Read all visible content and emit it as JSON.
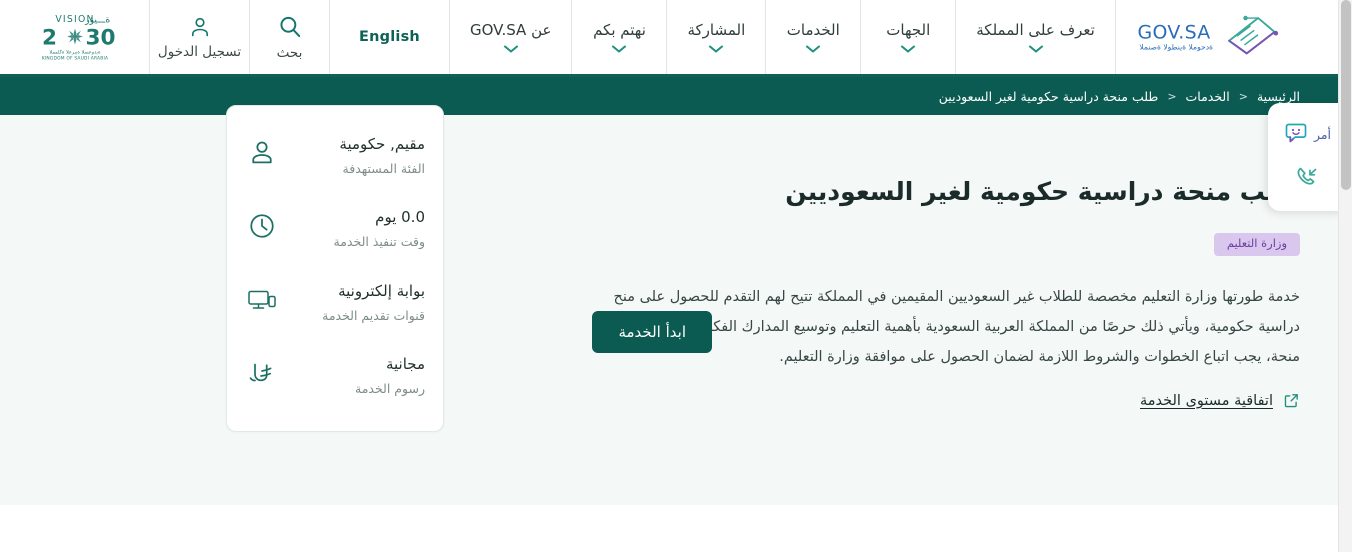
{
  "header": {
    "vision_logo": {
      "name": "vision-2030-logo",
      "word_vision": "VISION",
      "word_vision_ar": "رؤية",
      "year": "2030",
      "sub_ar": "المملكة العربية السعودية",
      "sub_en": "KINGDOM OF SAUDI ARABIA"
    },
    "login": {
      "label": "تسجيل الدخول",
      "icon": "user-icon"
    },
    "search": {
      "label": "بحث",
      "icon": "search-icon"
    },
    "language": {
      "label": "English"
    },
    "nav": [
      {
        "label": "عن GOV.SA",
        "icon": "chevron-down-icon"
      },
      {
        "label": "نهتم بكم",
        "icon": "chevron-down-icon"
      },
      {
        "label": "المشاركة",
        "icon": "chevron-down-icon"
      },
      {
        "label": "الخدمات",
        "icon": "chevron-down-icon"
      },
      {
        "label": "الجهات",
        "icon": "chevron-down-icon"
      },
      {
        "label": "تعرف على المملكة",
        "icon": "chevron-down-icon"
      }
    ],
    "govsa_logo": {
      "name": "govsa-logo",
      "wordmark": "GOV.SA",
      "tagline": "المنصة الوطنية الموحدة"
    }
  },
  "breadcrumb": {
    "items": [
      {
        "label": "الرئيسية"
      },
      {
        "label": "الخدمات"
      },
      {
        "label": "طلب منحة دراسية حكومية لغير السعوديين"
      }
    ],
    "separator": "<"
  },
  "service": {
    "title": "طلب منحة دراسية حكومية لغير السعوديين",
    "ministry_badge": "وزارة التعليم",
    "description": "خدمة طورتها وزارة التعليم مخصصة للطلاب غير السعوديين المقيمين في المملكة تتيح لهم التقدم للحصول على منح دراسية حكومية، ويأتي ذلك حرصًا من المملكة العربية السعودية بأهمية التعليم وتوسيع المدارك الفكرية. وللتقدم بطلب منحة، يجب اتباع الخطوات والشروط اللازمة لضمان الحصول على موافقة وزارة التعليم.",
    "sla_link": "اتفاقية مستوى الخدمة",
    "sla_icon": "external-link-icon",
    "start_button": "ابدأ الخدمة"
  },
  "info_card": {
    "rows": [
      {
        "icon": "person-icon",
        "value": "مقيم, حكومية",
        "label": "الفئة المستهدفة"
      },
      {
        "icon": "clock-icon",
        "value": "0.0 يوم",
        "label": "وقت تنفيذ الخدمة"
      },
      {
        "icon": "devices-icon",
        "value": "بوابة إلكترونية",
        "label": "قنوات تقديم الخدمة"
      },
      {
        "icon": "riyal-icon",
        "value": "مجانية",
        "label": "رسوم الخدمة"
      }
    ]
  },
  "float_widget": {
    "chat": {
      "label": "أمر",
      "icon": "chat-bubble-smile-icon"
    },
    "callback": {
      "label": "",
      "icon": "phone-callback-icon"
    }
  },
  "colors": {
    "brand_teal": "#0b5b52",
    "header_underline": "#0d6157",
    "hero_bg": "#f4f8f7",
    "badge_bg": "#d9c7ee",
    "badge_text": "#6b3fa0",
    "govsa_blue": "#2b6cb8",
    "accent_purple": "#6b3fa0"
  }
}
